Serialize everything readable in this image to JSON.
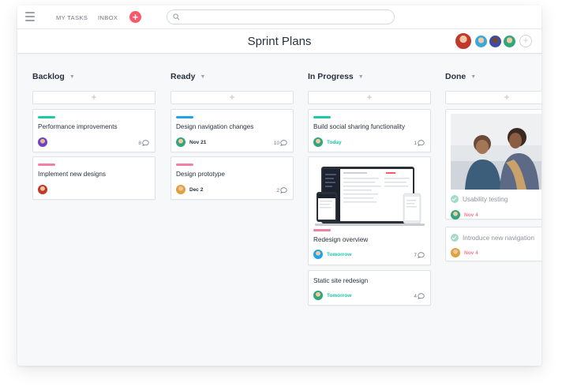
{
  "topbar": {
    "my_tasks": "MY TASKS",
    "inbox": "INBOX",
    "add_symbol": "+",
    "search_placeholder": ""
  },
  "header": {
    "title": "Sprint Plans",
    "add_member_symbol": "+"
  },
  "colors": {
    "accent_red": "#f95a6a",
    "tag_green": "#1ec9a5",
    "tag_blue": "#1fa4e8",
    "tag_pink": "#f57fa1",
    "due_today": "#1ec9a5",
    "due_future": "#f47b8d",
    "done_check": "#a3dbcb"
  },
  "columns": [
    {
      "name": "Backlog",
      "add": "+",
      "cards": [
        {
          "title": "Performance improvements",
          "tag": "green",
          "due": "",
          "comments": "8"
        },
        {
          "title": "Implement new designs",
          "tag": "pink",
          "due": "",
          "comments": ""
        }
      ]
    },
    {
      "name": "Ready",
      "add": "+",
      "cards": [
        {
          "title": "Design navigation changes",
          "tag": "blue",
          "due": "Nov 21",
          "comments": "10"
        },
        {
          "title": "Design prototype",
          "tag": "pink",
          "due": "Dec 2",
          "comments": "2"
        }
      ]
    },
    {
      "name": "In Progress",
      "add": "+",
      "cards": [
        {
          "title": "Build social sharing functionality",
          "tag": "green",
          "due": "Today",
          "comments": "1"
        },
        {
          "title": "Redesign overview",
          "tag": "pink",
          "due": "Tomorrow",
          "comments": "7"
        },
        {
          "title": "Static site redesign",
          "tag": "",
          "due": "Tomorrow",
          "comments": "4"
        }
      ]
    },
    {
      "name": "Done",
      "add": "+",
      "cards": [
        {
          "title": "Usability testing",
          "due": "Nov 4"
        },
        {
          "title": "Introduce new navigation",
          "due": "Nov 4"
        }
      ]
    }
  ]
}
